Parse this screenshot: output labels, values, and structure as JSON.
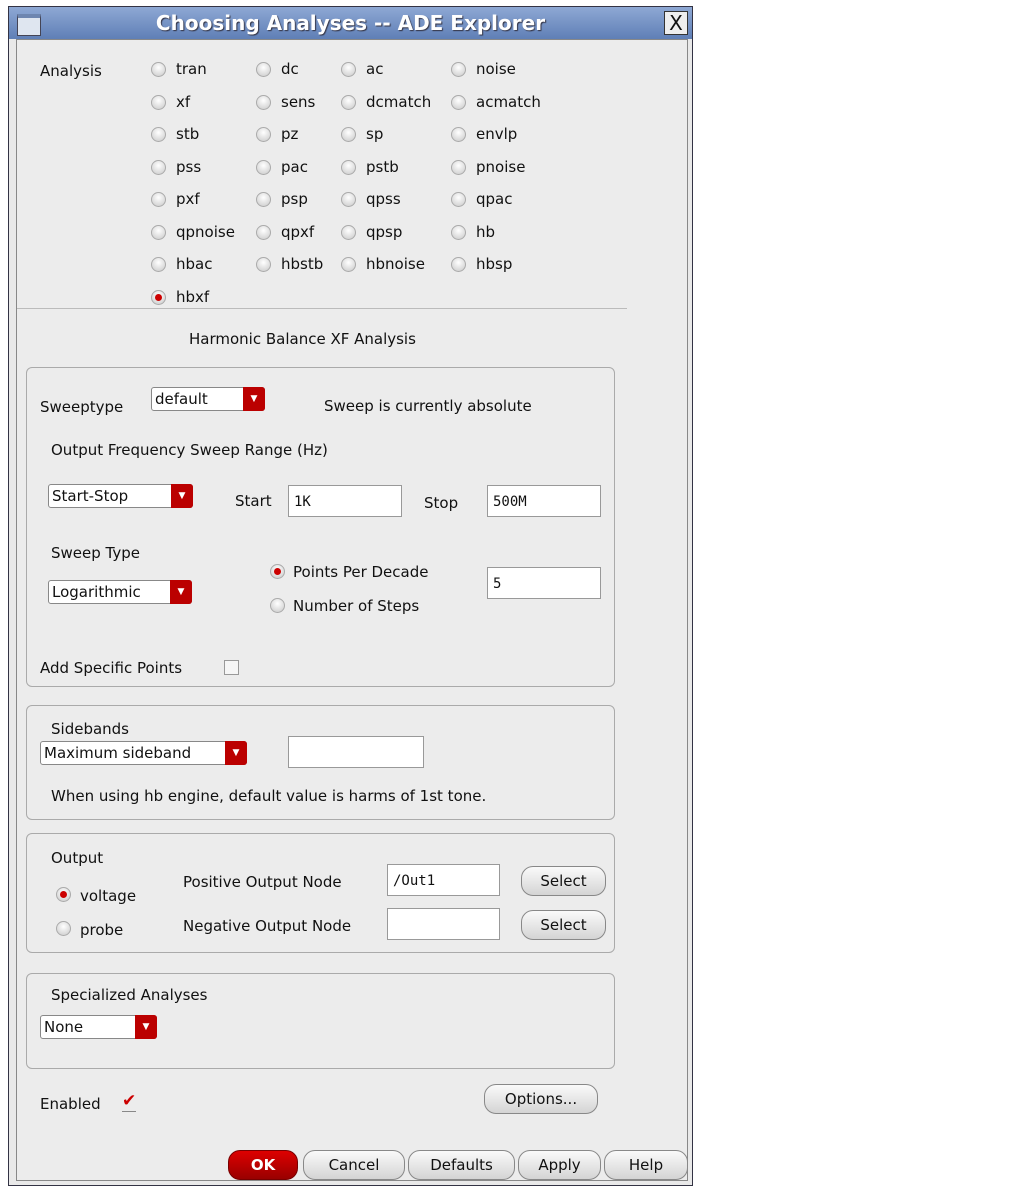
{
  "window": {
    "title": "Choosing Analyses -- ADE Explorer",
    "close": "X"
  },
  "analysis": {
    "label": "Analysis",
    "options": [
      [
        "tran",
        "dc",
        "ac",
        "noise"
      ],
      [
        "xf",
        "sens",
        "dcmatch",
        "acmatch"
      ],
      [
        "stb",
        "pz",
        "sp",
        "envlp"
      ],
      [
        "pss",
        "pac",
        "pstb",
        "pnoise"
      ],
      [
        "pxf",
        "psp",
        "qpss",
        "qpac"
      ],
      [
        "qpnoise",
        "qpxf",
        "qpsp",
        "hb"
      ],
      [
        "hbac",
        "hbstb",
        "hbnoise",
        "hbsp"
      ],
      [
        "hbxf"
      ]
    ],
    "selected": "hbxf"
  },
  "section_title": "Harmonic Balance XF Analysis",
  "sweep": {
    "sweeptype_label": "Sweeptype",
    "sweeptype_value": "default",
    "status": "Sweep is currently absolute",
    "range_label": "Output Frequency Sweep Range (Hz)",
    "range_mode": "Start-Stop",
    "start_label": "Start",
    "start_value": "1K",
    "stop_label": "Stop",
    "stop_value": "500M",
    "type_label": "Sweep Type",
    "type_value": "Logarithmic",
    "ppd_label": "Points Per Decade",
    "steps_label": "Number of Steps",
    "ppd_value": "5",
    "add_points_label": "Add Specific Points"
  },
  "sidebands": {
    "label": "Sidebands",
    "mode": "Maximum sideband",
    "value": "",
    "note": "When using hb engine, default value is harms of 1st tone."
  },
  "output": {
    "label": "Output",
    "voltage": "voltage",
    "probe": "probe",
    "pos_label": "Positive Output Node",
    "pos_value": "/Out1",
    "neg_label": "Negative Output Node",
    "neg_value": "",
    "select": "Select"
  },
  "specialized": {
    "label": "Specialized Analyses",
    "value": "None"
  },
  "enabled_label": "Enabled",
  "options_button": "Options...",
  "buttons": {
    "ok": "OK",
    "cancel": "Cancel",
    "defaults": "Defaults",
    "apply": "Apply",
    "help": "Help"
  }
}
